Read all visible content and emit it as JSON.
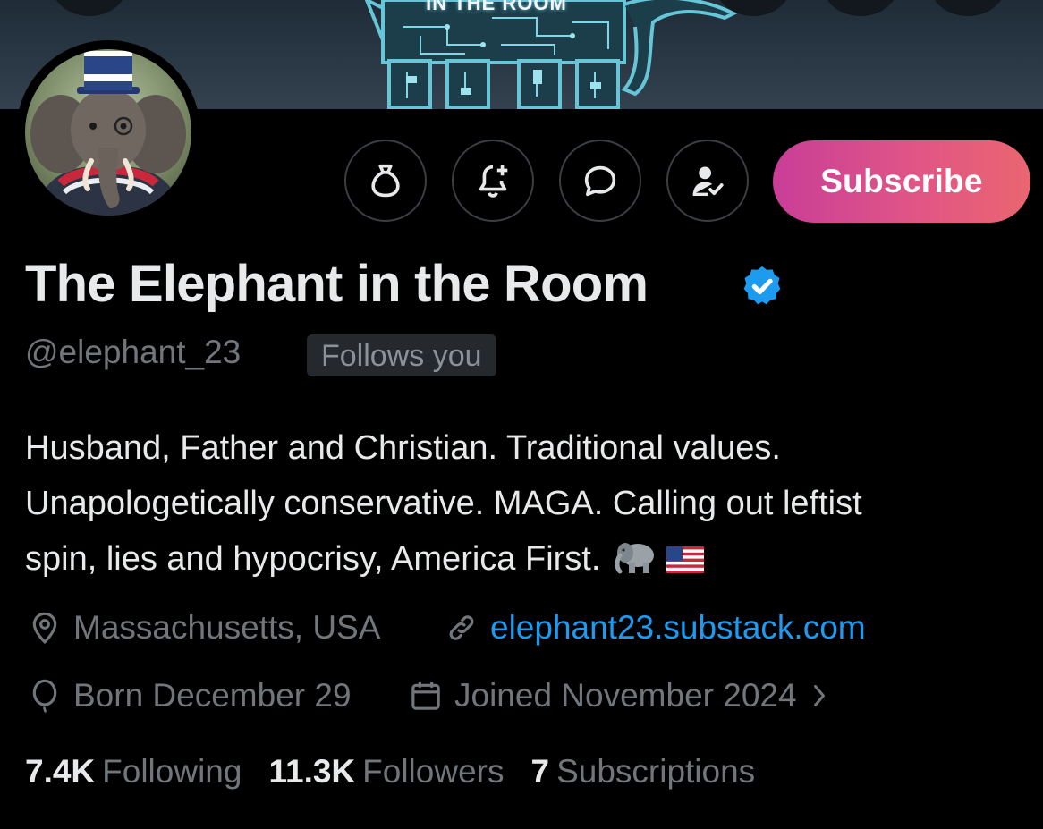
{
  "banner": {
    "caption": "IN THE ROOM"
  },
  "profile": {
    "display_name": "The Elephant in the Room",
    "handle": "@elephant_23",
    "follows_badge": "Follows you",
    "bio_lines": [
      "Husband, Father and Christian. Traditional values.",
      "Unapologetically conservative. MAGA. Calling out leftist",
      "spin, lies and hypocrisy, America First."
    ],
    "bio_emoji": [
      "elephant",
      "us-flag"
    ],
    "location": "Massachusetts, USA",
    "website": "elephant23.substack.com",
    "birthday": "Born December 29",
    "joined": "Joined November 2024"
  },
  "actions": {
    "subscribe_label": "Subscribe",
    "icons": [
      "money-bag-icon",
      "notification-bell-plus-icon",
      "message-icon",
      "following-person-check-icon"
    ]
  },
  "stats": {
    "following_count": "7.4K",
    "following_label": "Following",
    "followers_count": "11.3K",
    "followers_label": "Followers",
    "subscriptions_count": "7",
    "subscriptions_label": "Subscriptions"
  },
  "colors": {
    "background": "#000000",
    "text_primary": "#e7e9ea",
    "text_secondary": "#71767b",
    "link": "#1d9bf0",
    "verified": "#1d9bf0",
    "subscribe_gradient_start": "#c93e97",
    "subscribe_gradient_end": "#ea6670"
  }
}
